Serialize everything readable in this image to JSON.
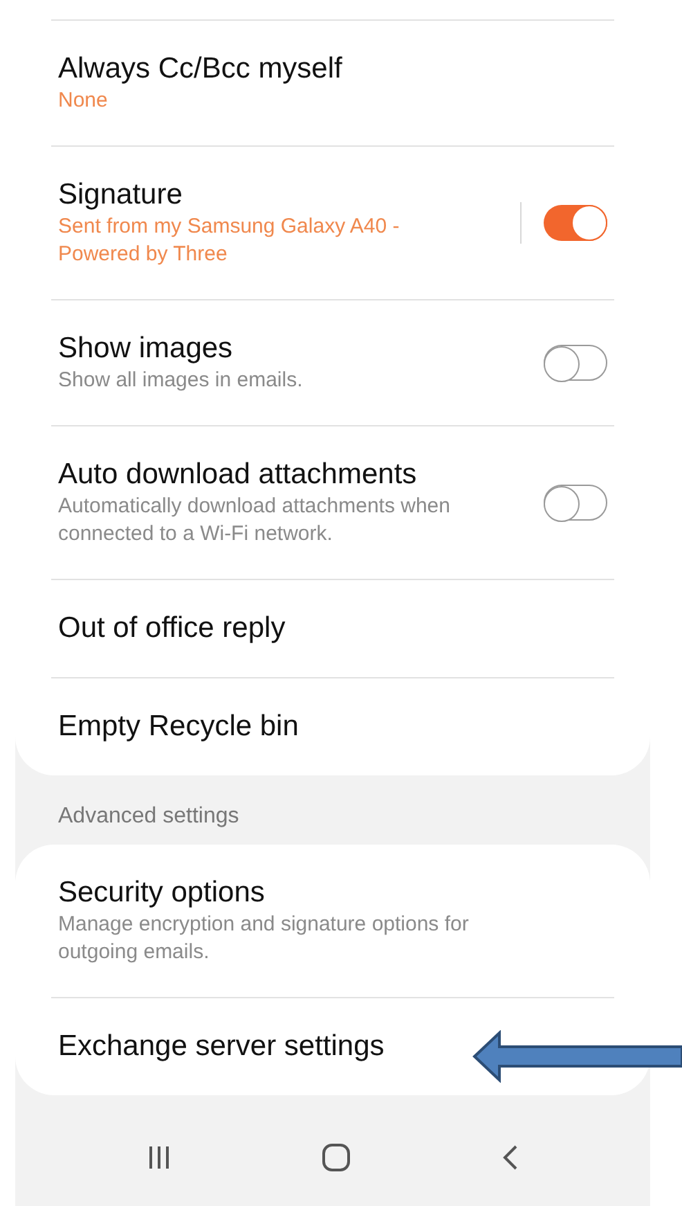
{
  "settings": [
    {
      "title": "Always Cc/Bcc myself",
      "value": "None"
    },
    {
      "title": "Signature",
      "value": "Sent from my Samsung Galaxy A40 - Powered by Three",
      "on": true
    },
    {
      "title": "Show images",
      "description": "Show all images in emails.",
      "on": false
    },
    {
      "title": "Auto download attachments",
      "description": "Automatically download attachments when connected to a Wi-Fi network.",
      "on": false
    },
    {
      "title": "Out of office reply"
    },
    {
      "title": "Empty Recycle bin"
    }
  ],
  "advanced": {
    "header": "Advanced settings",
    "items": [
      {
        "title": "Security options",
        "description": "Manage encryption and signature options for outgoing emails."
      },
      {
        "title": "Exchange server settings"
      }
    ]
  }
}
